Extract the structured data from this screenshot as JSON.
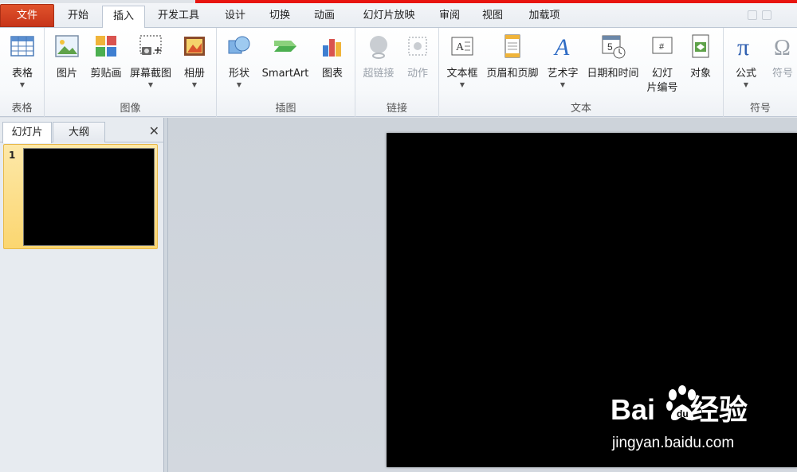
{
  "tabs": [
    {
      "label": "文件"
    },
    {
      "label": "开始"
    },
    {
      "label": "插入"
    },
    {
      "label": "开发工具"
    },
    {
      "label": "设计"
    },
    {
      "label": "切换"
    },
    {
      "label": "动画"
    },
    {
      "label": "幻灯片放映"
    },
    {
      "label": "审阅"
    },
    {
      "label": "视图"
    },
    {
      "label": "加载项"
    }
  ],
  "active_tab": "插入",
  "ribbon": {
    "groups": {
      "table": "表格",
      "image": "图像",
      "illustrations": "插图",
      "links": "链接",
      "text": "文本",
      "symbols": "符号"
    },
    "buttons": {
      "table": "表格",
      "picture": "图片",
      "clipart": "剪贴画",
      "screenshot": "屏幕截图",
      "album": "相册",
      "shapes": "形状",
      "smartart": "SmartArt",
      "chart": "图表",
      "hyperlink": "超链接",
      "action": "动作",
      "textbox": "文本框",
      "header_footer": "页眉和页脚",
      "wordart": "艺术字",
      "datetime": "日期和时间",
      "slide_number_1": "幻灯",
      "slide_number_2": "片编号",
      "object": "对象",
      "equation": "公式",
      "symbol": "符号"
    }
  },
  "left_pane": {
    "tab_slides": "幻灯片",
    "tab_outline": "大纲",
    "close": "✕",
    "slides": [
      {
        "number": "1"
      }
    ]
  },
  "watermark": {
    "logo_left": "Bai",
    "logo_right": "经验",
    "url": "jingyan.baidu.com"
  },
  "colors": {
    "file_tab": "#d2401f",
    "accent_red": "#e8150f",
    "thumb_highlight": "#fbd670"
  }
}
